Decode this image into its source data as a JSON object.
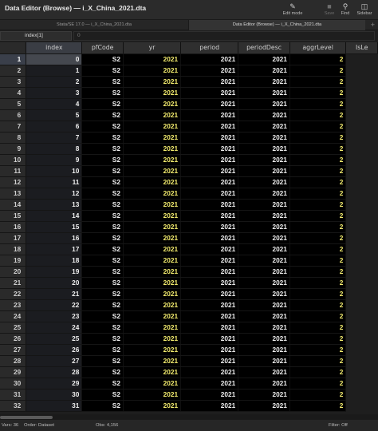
{
  "window": {
    "title": "Data Editor (Browse) — i_X_China_2021.dta"
  },
  "toolbar": {
    "edit_mode": "Edit mode",
    "save": "Save",
    "find": "Find",
    "sidebar": "Sidebar"
  },
  "tabs": {
    "left": "Stata/SE 17.0 — i_X_China_2021.dta",
    "right": "Data Editor (Browse) — i_X_China_2021.dta",
    "add": "+"
  },
  "cell_bar": {
    "varname": "index[1]",
    "value": "0"
  },
  "columns": [
    "index",
    "pfCode",
    "yr",
    "period",
    "periodDesc",
    "aggrLevel",
    "IsLe"
  ],
  "rows": [
    [
      "1",
      "0",
      "S2",
      "2021",
      "2021",
      "2021",
      "2"
    ],
    [
      "2",
      "1",
      "S2",
      "2021",
      "2021",
      "2021",
      "2"
    ],
    [
      "3",
      "2",
      "S2",
      "2021",
      "2021",
      "2021",
      "2"
    ],
    [
      "4",
      "3",
      "S2",
      "2021",
      "2021",
      "2021",
      "2"
    ],
    [
      "5",
      "4",
      "S2",
      "2021",
      "2021",
      "2021",
      "2"
    ],
    [
      "6",
      "5",
      "S2",
      "2021",
      "2021",
      "2021",
      "2"
    ],
    [
      "7",
      "6",
      "S2",
      "2021",
      "2021",
      "2021",
      "2"
    ],
    [
      "8",
      "7",
      "S2",
      "2021",
      "2021",
      "2021",
      "2"
    ],
    [
      "9",
      "8",
      "S2",
      "2021",
      "2021",
      "2021",
      "2"
    ],
    [
      "10",
      "9",
      "S2",
      "2021",
      "2021",
      "2021",
      "2"
    ],
    [
      "11",
      "10",
      "S2",
      "2021",
      "2021",
      "2021",
      "2"
    ],
    [
      "12",
      "11",
      "S2",
      "2021",
      "2021",
      "2021",
      "2"
    ],
    [
      "13",
      "12",
      "S2",
      "2021",
      "2021",
      "2021",
      "2"
    ],
    [
      "14",
      "13",
      "S2",
      "2021",
      "2021",
      "2021",
      "2"
    ],
    [
      "15",
      "14",
      "S2",
      "2021",
      "2021",
      "2021",
      "2"
    ],
    [
      "16",
      "15",
      "S2",
      "2021",
      "2021",
      "2021",
      "2"
    ],
    [
      "17",
      "16",
      "S2",
      "2021",
      "2021",
      "2021",
      "2"
    ],
    [
      "18",
      "17",
      "S2",
      "2021",
      "2021",
      "2021",
      "2"
    ],
    [
      "19",
      "18",
      "S2",
      "2021",
      "2021",
      "2021",
      "2"
    ],
    [
      "20",
      "19",
      "S2",
      "2021",
      "2021",
      "2021",
      "2"
    ],
    [
      "21",
      "20",
      "S2",
      "2021",
      "2021",
      "2021",
      "2"
    ],
    [
      "22",
      "21",
      "S2",
      "2021",
      "2021",
      "2021",
      "2"
    ],
    [
      "23",
      "22",
      "S2",
      "2021",
      "2021",
      "2021",
      "2"
    ],
    [
      "24",
      "23",
      "S2",
      "2021",
      "2021",
      "2021",
      "2"
    ],
    [
      "25",
      "24",
      "S2",
      "2021",
      "2021",
      "2021",
      "2"
    ],
    [
      "26",
      "25",
      "S2",
      "2021",
      "2021",
      "2021",
      "2"
    ],
    [
      "27",
      "26",
      "S2",
      "2021",
      "2021",
      "2021",
      "2"
    ],
    [
      "28",
      "27",
      "S2",
      "2021",
      "2021",
      "2021",
      "2"
    ],
    [
      "29",
      "28",
      "S2",
      "2021",
      "2021",
      "2021",
      "2"
    ],
    [
      "30",
      "29",
      "S2",
      "2021",
      "2021",
      "2021",
      "2"
    ],
    [
      "31",
      "30",
      "S2",
      "2021",
      "2021",
      "2021",
      "2"
    ],
    [
      "32",
      "31",
      "S2",
      "2021",
      "2021",
      "2021",
      "2"
    ]
  ],
  "string_columns": [
    2,
    5
  ],
  "status": {
    "vars": "Vars: 36",
    "order": "Order: Dataset",
    "obs": "Obs: 4,156",
    "filter": "Filter: Off"
  },
  "colors": {
    "string_text": "#f3ec6e",
    "cell_bg": "#000000",
    "header_bg": "#2f2f2f"
  }
}
